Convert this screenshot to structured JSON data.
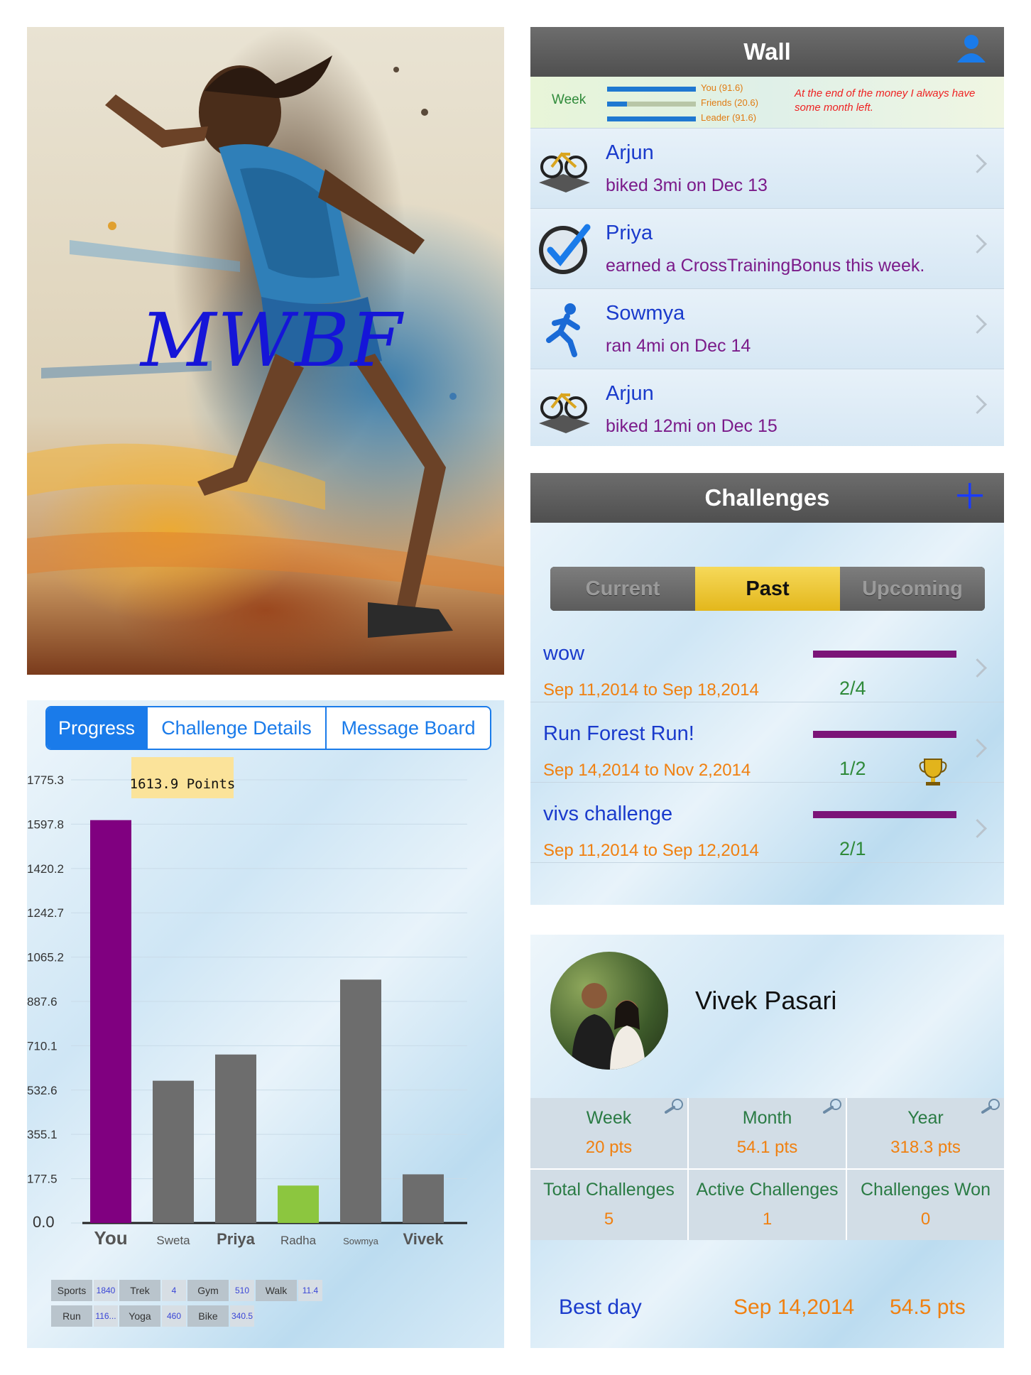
{
  "poster": {
    "logo_text": "MWBF"
  },
  "wall": {
    "title": "Wall",
    "week_label": "Week",
    "bars": [
      {
        "label": "You (91.6)",
        "fraction": 1.0
      },
      {
        "label": "Friends (20.6)",
        "fraction": 0.22
      },
      {
        "label": "Leader (91.6)",
        "fraction": 1.0
      }
    ],
    "quote": "At the end of the money I always have some month left.",
    "feed": [
      {
        "name": "Arjun",
        "text": "biked 3mi on Dec 13",
        "icon": "bike-icon"
      },
      {
        "name": "Priya",
        "text": "earned a CrossTrainingBonus this week.",
        "icon": "checkmark-icon"
      },
      {
        "name": "Sowmya",
        "text": "ran 4mi on Dec 14",
        "icon": "runner-icon"
      },
      {
        "name": "Arjun",
        "text": "biked 12mi on Dec 15",
        "icon": "bike-icon"
      }
    ]
  },
  "challenges": {
    "title": "Challenges",
    "segments": [
      "Current",
      "Past",
      "Upcoming"
    ],
    "selected_segment": "Past",
    "items": [
      {
        "name": "wow",
        "date": "Sep 11,2014  to Sep 18,2014",
        "score": "2/4",
        "trophy": false
      },
      {
        "name": "Run Forest Run!",
        "date": "Sep 14,2014  to Nov 2,2014",
        "score": "1/2",
        "trophy": true
      },
      {
        "name": "vivs challenge",
        "date": "Sep 11,2014  to Sep 12,2014",
        "score": "2/1",
        "trophy": false
      }
    ]
  },
  "profile": {
    "name": "Vivek Pasari",
    "stats": [
      {
        "label": "Week",
        "value": "20 pts",
        "search": true
      },
      {
        "label": "Month",
        "value": "54.1 pts",
        "search": true
      },
      {
        "label": "Year",
        "value": "318.3 pts",
        "search": true
      },
      {
        "label": "Total Challenges",
        "value": "5",
        "search": false
      },
      {
        "label": "Active Challenges",
        "value": "1",
        "search": false
      },
      {
        "label": "Challenges Won",
        "value": "0",
        "search": false
      }
    ],
    "best_day": {
      "label": "Best day",
      "date": "Sep 14,2014",
      "points": "54.5 pts"
    }
  },
  "progress": {
    "tabs": [
      "Progress",
      "Challenge Details",
      "Message Board"
    ],
    "active_tab": "Progress",
    "tooltip": "1613.9 Points",
    "breakdown_row1": [
      [
        "Sports",
        "1840"
      ],
      [
        "Trek",
        "4"
      ],
      [
        "Gym",
        "510"
      ],
      [
        "Walk",
        "11.4"
      ]
    ],
    "breakdown_row2": [
      [
        "Run",
        "116..."
      ],
      [
        "Yoga",
        "460"
      ],
      [
        "Bike",
        "340.5"
      ]
    ]
  },
  "colors": {
    "purple": "#800080",
    "gray": "#6d6d6d",
    "green": "#8cc63f",
    "blue": "#1a3bcc",
    "orange": "#f08010"
  },
  "chart_data": {
    "type": "bar",
    "categories": [
      "You",
      "Sweta",
      "Priya",
      "Radha",
      "Sowmya",
      "Vivek"
    ],
    "values": [
      1613.9,
      570,
      675,
      150,
      975,
      195
    ],
    "bar_colors": [
      "#800080",
      "#6d6d6d",
      "#6d6d6d",
      "#8cc63f",
      "#6d6d6d",
      "#6d6d6d"
    ],
    "yticks": [
      "0.0",
      "177.5",
      "355.1",
      "532.6",
      "710.1",
      "887.6",
      "1065.2",
      "1242.7",
      "1420.2",
      "1597.8",
      "1775.3"
    ],
    "ylim": [
      0,
      1775.3
    ],
    "title": "",
    "xlabel": "",
    "ylabel": ""
  }
}
